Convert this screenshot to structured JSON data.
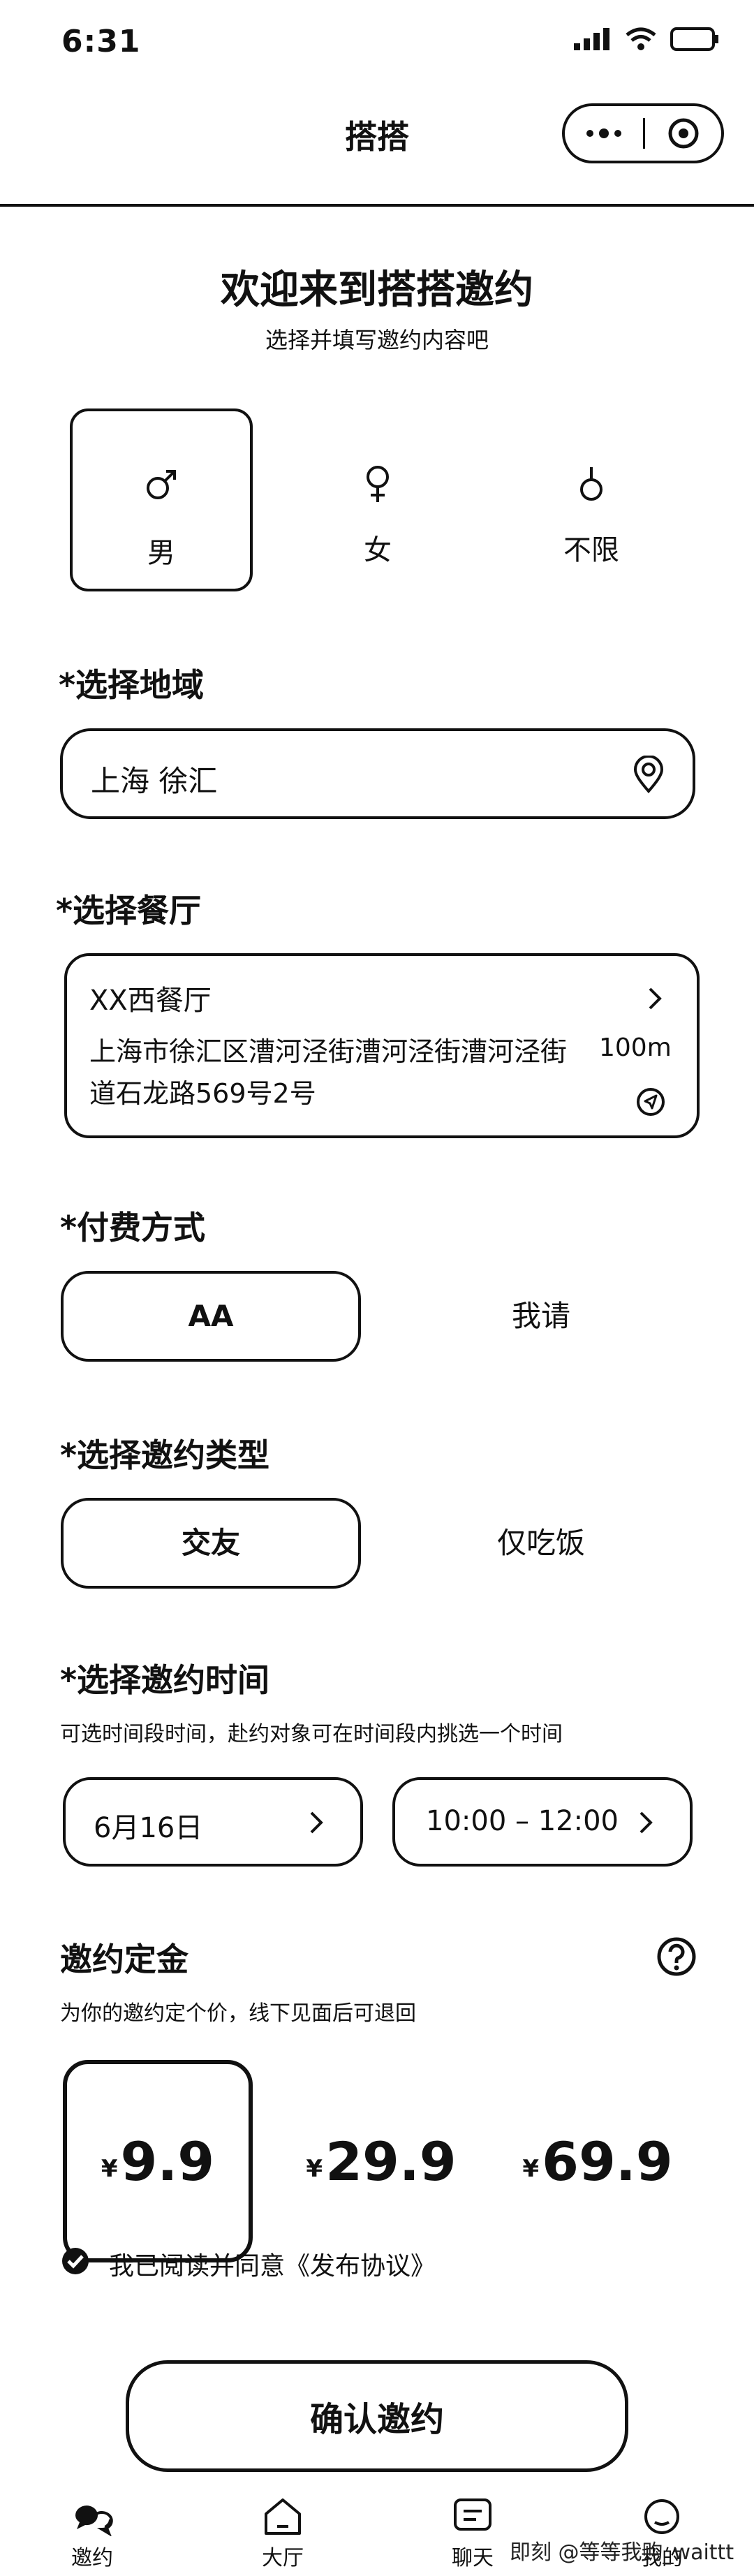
{
  "status_bar": {
    "time": "6:31"
  },
  "header": {
    "title": "搭搭"
  },
  "welcome": {
    "title": "欢迎来到搭搭邀约",
    "subtitle": "选择并填写邀约内容吧"
  },
  "gender": {
    "options": [
      {
        "label": "男",
        "icon": "male-icon"
      },
      {
        "label": "女",
        "icon": "female-icon"
      },
      {
        "label": "不限",
        "icon": "neutral-gender-icon"
      }
    ],
    "selected": "男"
  },
  "region": {
    "title": "*选择地域",
    "value": "上海 徐汇",
    "icon": "location-pin-icon"
  },
  "restaurant": {
    "title": "*选择餐厅",
    "name": "XX西餐厅",
    "address": "上海市徐汇区漕河泾街漕河泾街漕河泾街道石龙路569号2号",
    "distance": "100m"
  },
  "payment": {
    "title": "*付费方式",
    "options": [
      "AA",
      "我请"
    ],
    "selected": "AA"
  },
  "invite_type": {
    "title": "*选择邀约类型",
    "options": [
      "交友",
      "仅吃饭"
    ],
    "selected": "交友"
  },
  "invite_time": {
    "title": "*选择邀约时间",
    "desc": "可选时间段时间，赴约对象可在时间段内挑选一个时间",
    "date": "6月16日",
    "time_range": "10:00 – 12:00"
  },
  "deposit": {
    "title": "邀约定金",
    "desc": "为你的邀约定个价，线下见面后可退回",
    "currency": "¥",
    "options": [
      "9.9",
      "29.9",
      "69.9"
    ],
    "selected": "9.9"
  },
  "agreement": {
    "text": "我已阅读并同意《发布协议》",
    "checked": true
  },
  "confirm_button": {
    "label": "确认邀约"
  },
  "tabbar": {
    "items": [
      "邀约",
      "大厅",
      "聊天",
      "我的"
    ],
    "active": "邀约"
  },
  "watermark": {
    "text": "即刻 @等等我购_waittt"
  }
}
